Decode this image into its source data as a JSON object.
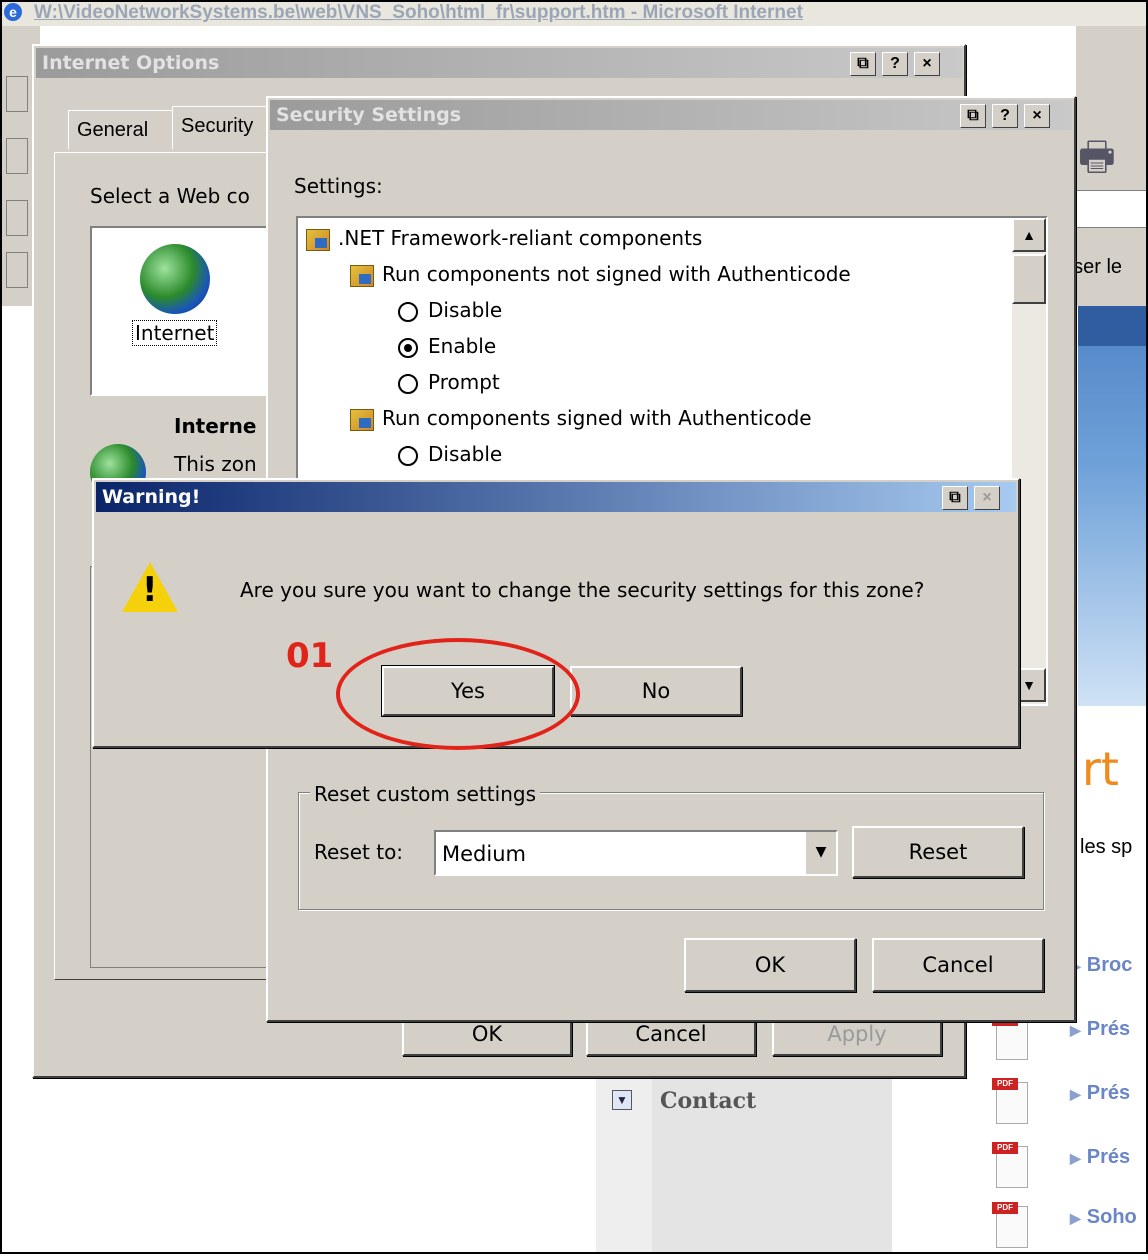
{
  "browser": {
    "title": "W:\\VideoNetworkSystems.be\\web\\VNS_Soho\\html_fr\\support.htm - Microsoft Internet",
    "autoriser_text": "riser le",
    "page_heading_fragment": "rt",
    "page_text_fragment": "les sp",
    "contact_label": "Contact",
    "doc_links": [
      "Broc",
      "Prés",
      "Prés",
      "Prés",
      "Soho"
    ],
    "pdf_label": "PDF"
  },
  "internet_options": {
    "title": "Internet Options",
    "tabs": [
      "General",
      "Security"
    ],
    "select_zone_text": "Select a Web co",
    "zone_label": "Internet",
    "zone_heading": "Interne",
    "zone_desc": "This zon",
    "buttons": {
      "ok": "OK",
      "cancel": "Cancel",
      "apply": "Apply"
    }
  },
  "security_settings": {
    "title": "Security Settings",
    "settings_label": "Settings:",
    "tree": [
      {
        "kind": "category",
        "text": ".NET Framework-reliant components"
      },
      {
        "kind": "setting",
        "text": "Run components not signed with Authenticode"
      },
      {
        "kind": "option",
        "text": "Disable",
        "selected": false
      },
      {
        "kind": "option",
        "text": "Enable",
        "selected": true
      },
      {
        "kind": "option",
        "text": "Prompt",
        "selected": false
      },
      {
        "kind": "setting",
        "text": "Run components signed with Authenticode"
      },
      {
        "kind": "option",
        "text": "Disable",
        "selected": false
      }
    ],
    "reset_group_label": "Reset custom settings",
    "reset_to_label": "Reset to:",
    "reset_to_value": "Medium",
    "reset_button": "Reset",
    "ok_button": "OK",
    "cancel_button": "Cancel"
  },
  "warning": {
    "title": "Warning!",
    "message": "Are you sure you want to change the security settings for this zone?",
    "yes": "Yes",
    "no": "No"
  },
  "annotation": {
    "step_number": "01",
    "color": "#e2231a"
  },
  "title_buttons": {
    "help": "?",
    "close": "×",
    "context": "⧉"
  }
}
